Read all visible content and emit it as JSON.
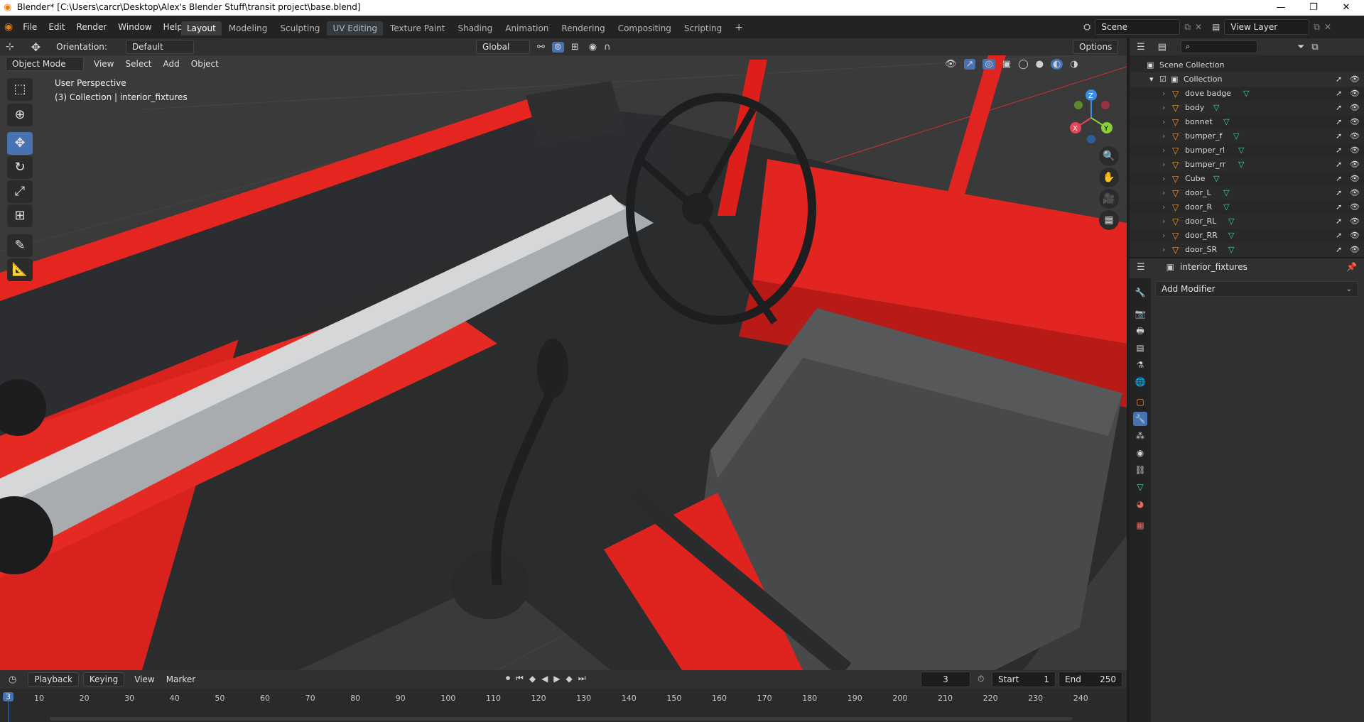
{
  "window": {
    "title": "Blender* [C:\\Users\\carcr\\Desktop\\Alex's Blender Stuff\\transit project\\base.blend]",
    "minimize": "—",
    "maximize": "❐",
    "close": "✕"
  },
  "topbar": {
    "menus": [
      "File",
      "Edit",
      "Render",
      "Window",
      "Help"
    ],
    "workspaces": [
      "Layout",
      "Modeling",
      "Sculpting",
      "UV Editing",
      "Texture Paint",
      "Shading",
      "Animation",
      "Rendering",
      "Compositing",
      "Scripting"
    ],
    "active_workspace": "Layout",
    "add_workspace": "+",
    "scene_label": "Scene",
    "view_layer_label": "View Layer"
  },
  "viewport": {
    "orientation_label": "Orientation:",
    "orientation_value": "Default",
    "transform_orientation": "Global",
    "options_label": "Options",
    "mode": "Object Mode",
    "menus": [
      "View",
      "Select",
      "Add",
      "Object"
    ],
    "overlay_title": "User Perspective",
    "overlay_subtitle": "(3) Collection | interior_fixtures",
    "gizmo_axes": [
      "Z",
      "X",
      "Y"
    ],
    "colors": {
      "red": "#e0201c",
      "dark": "#2f3032",
      "steel": "#b9bcbd"
    }
  },
  "outliner": {
    "root": "Scene Collection",
    "collection": "Collection",
    "items": [
      "dove badge",
      "body",
      "bonnet",
      "bumper_f",
      "bumper_rl",
      "bumper_rr",
      "Cube",
      "door_L",
      "door_R",
      "door_RL",
      "door_RR",
      "door_SR"
    ]
  },
  "properties": {
    "object_name": "interior_fixtures",
    "add_modifier": "Add Modifier"
  },
  "timeline": {
    "menus": [
      "Playback",
      "Keying",
      "View",
      "Marker"
    ],
    "current_frame": "3",
    "start_label": "Start",
    "start_value": "1",
    "end_label": "End",
    "end_value": "250",
    "frame_badge": "3",
    "ticks": [
      "10",
      "20",
      "30",
      "40",
      "50",
      "60",
      "70",
      "80",
      "90",
      "100",
      "110",
      "120",
      "130",
      "140",
      "150",
      "160",
      "170",
      "180",
      "190",
      "200",
      "210",
      "220",
      "230",
      "240"
    ]
  }
}
